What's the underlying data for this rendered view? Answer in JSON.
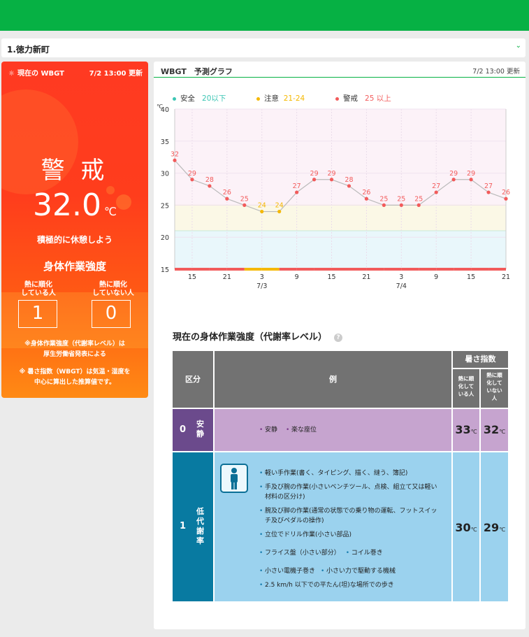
{
  "location": {
    "selected": "1.徳力新町",
    "chevron_icon": "chevron-down-icon"
  },
  "current": {
    "header": "現在の WBGT",
    "updated": "7/2 13:00 更新",
    "level": "警 戒",
    "temperature": "32.0",
    "unit": "℃",
    "advice": "積極的に休憩しよう",
    "intensity_title": "身体作業強度",
    "acclimatized_label": "熱に順化\nしている人",
    "acclimatized_value": "1",
    "not_acclimatized_label": "熱に順化\nしていない人",
    "not_acclimatized_value": "0",
    "note1": "※身体作業強度（代謝率レベル）は\n厚生労働省発表による",
    "note2": "※ 暑さ指数（WBGT）は気温・湿度を\n中心に算出した推算値です。"
  },
  "graph": {
    "title": "WBGT　予測グラフ",
    "updated": "7/2 13:00 更新",
    "legend": [
      {
        "name": "安全",
        "range": "20以下",
        "color": "#3cc6b4"
      },
      {
        "name": "注意",
        "range": "21-24",
        "color": "#f5b800"
      },
      {
        "name": "警戒",
        "range": "25 以上",
        "color": "#f25b5b"
      }
    ]
  },
  "chart_data": {
    "type": "line",
    "ylabel": "℃",
    "ylim": [
      15,
      40
    ],
    "yticks": [
      15,
      20,
      25,
      30,
      35,
      40
    ],
    "x_hours_from_start": [
      0,
      3,
      6,
      9,
      12,
      15,
      18,
      21,
      24,
      27,
      30,
      33,
      36,
      39,
      42,
      45,
      48,
      51,
      54,
      57,
      60,
      63,
      66,
      69,
      72
    ],
    "values": [
      32,
      29,
      28,
      26,
      25,
      24,
      24,
      27,
      29,
      29,
      28,
      26,
      25,
      25,
      25,
      27,
      29,
      29,
      27,
      26
    ],
    "xtick_labels": [
      "15",
      "21",
      "3",
      "9",
      "15",
      "21",
      "3",
      "9",
      "15",
      "21"
    ],
    "date_labels": [
      "7/3",
      "7/4"
    ],
    "zones": [
      {
        "name": "安全",
        "from": 15,
        "to": 21,
        "color": "#e9f7fb"
      },
      {
        "name": "注意",
        "from": 21,
        "to": 25,
        "color": "#fbf8e6"
      },
      {
        "name": "警戒",
        "from": 25,
        "to": 40,
        "color": "#fcf2f8"
      }
    ],
    "line_color": "#bbbbbb",
    "point_color": "#f25b5b",
    "low_point_color": "#f5b800"
  },
  "intensity_table": {
    "title": "現在の身体作業強度（代謝率レベル）",
    "help_icon": "question-icon",
    "headers": {
      "category": "区分",
      "example": "例",
      "heat_index": "暑さ指数",
      "acclimatized": "熱に順\n化して\nいる人",
      "not_acclimatized": "熱に順\n化して\nいない\n人"
    },
    "rows": [
      {
        "level": "0",
        "name": "安\n静",
        "examples": [
          "安静",
          "楽な座位"
        ],
        "acclimatized": "33",
        "not_acclimatized": "32",
        "color_dark": "#6b4a8c",
        "color_light": "#c6a4cf"
      },
      {
        "level": "1",
        "name": "低\n代\n謝\n率",
        "icon": "standing-person-icon",
        "examples": [
          "軽い手作業(書く、タイピング、描く、縫う、簿記)",
          "手及び腕の作業(小さいベンチツール、点検、組立て又は軽い材料の区分け)",
          "腕及び脚の作業(通常の状態での乗り物の運転、フットスイッチ及びペダルの操作)",
          "立位でドリル作業(小さい部品)",
          "フライス盤（小さい部分）",
          "コイル巻き",
          "小さい電機子巻き",
          "小さい力で駆動する機械",
          "2.5 km/h 以下での平たん(坦)な場所での歩き"
        ],
        "acclimatized": "30",
        "not_acclimatized": "29",
        "color_dark": "#087aa1",
        "color_light": "#9bd2ee"
      }
    ],
    "unit": "℃"
  }
}
